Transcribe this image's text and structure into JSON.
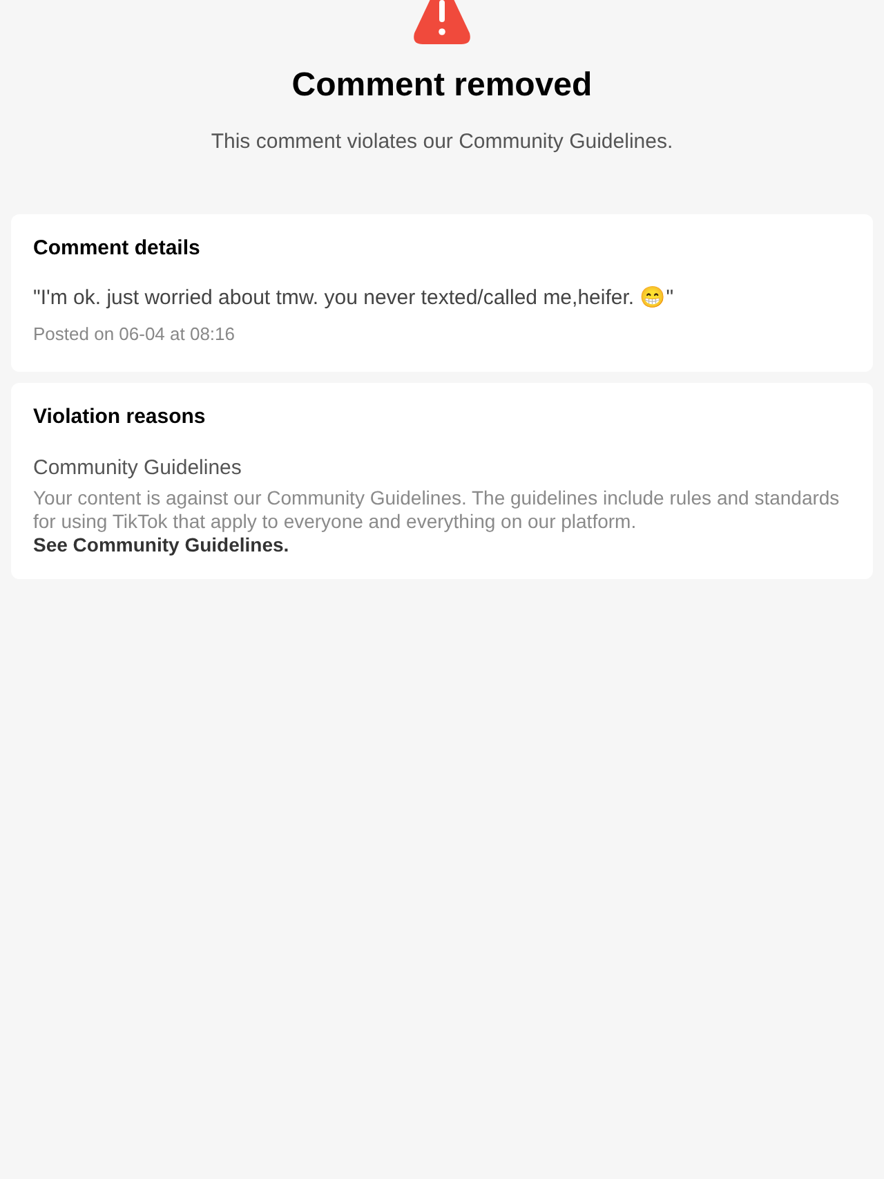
{
  "header": {
    "title": "Comment removed",
    "subtitle": "This comment violates our Community Guidelines."
  },
  "comment_details": {
    "heading": "Comment details",
    "comment": "\"I'm ok. just worried about tmw. you never texted/called me,heifer. 😁\"",
    "posted": "Posted on 06-04 at 08:16"
  },
  "violation_reasons": {
    "heading": "Violation reasons",
    "reason_title": "Community Guidelines",
    "description": "Your content is against our Community Guidelines. The guidelines include rules and standards for using TikTok that apply to everyone and everything on our platform.",
    "link": "See Community Guidelines."
  }
}
